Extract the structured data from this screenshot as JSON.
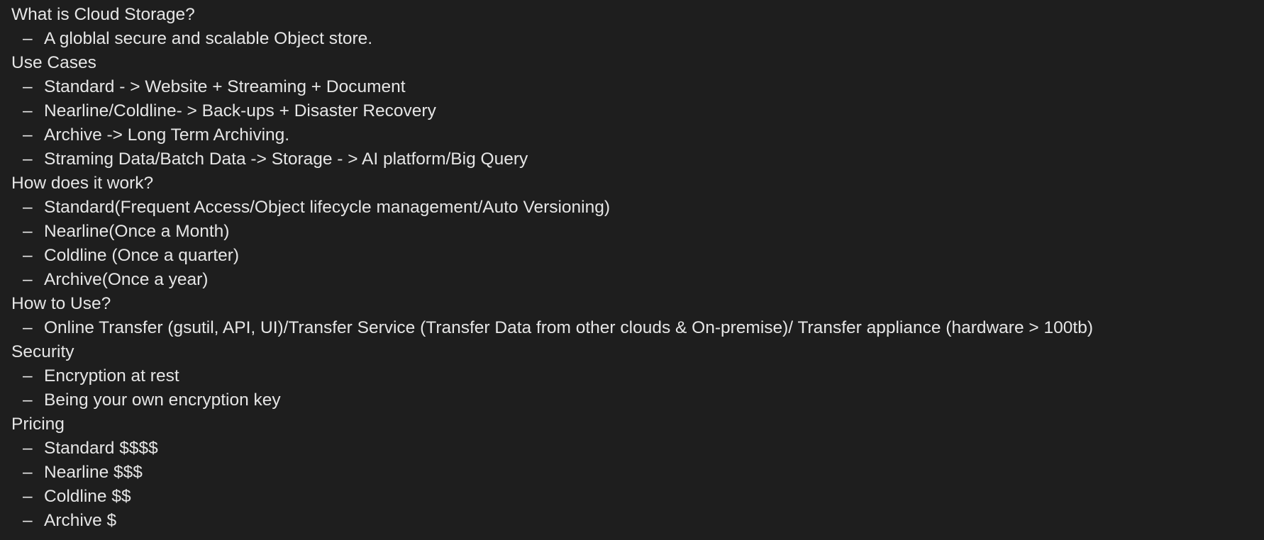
{
  "dash": "–",
  "sections": [
    {
      "heading": "What is Cloud Storage?",
      "items": [
        "A globlal secure and scalable Object store."
      ]
    },
    {
      "heading": "Use Cases",
      "items": [
        "Standard - > Website + Streaming + Document",
        "Nearline/Coldline- > Back-ups + Disaster Recovery",
        "Archive -> Long Term Archiving.",
        "Straming Data/Batch Data -> Storage - > AI platform/Big Query"
      ]
    },
    {
      "heading": "How does it work?",
      "items": [
        "Standard(Frequent Access/Object lifecycle management/Auto Versioning)",
        "Nearline(Once a Month)",
        "Coldline (Once a quarter)",
        "Archive(Once a year)"
      ]
    },
    {
      "heading": "How to Use?",
      "items": [
        "Online Transfer (gsutil, API, UI)/Transfer Service (Transfer Data from other clouds & On-premise)/ Transfer appliance (hardware > 100tb)"
      ]
    },
    {
      "heading": "Security",
      "items": [
        "Encryption at rest",
        "Being your own encryption key"
      ]
    },
    {
      "heading": "Pricing",
      "items": [
        "Standard $$$$",
        "Nearline $$$",
        "Coldline $$",
        "Archive $"
      ]
    }
  ]
}
